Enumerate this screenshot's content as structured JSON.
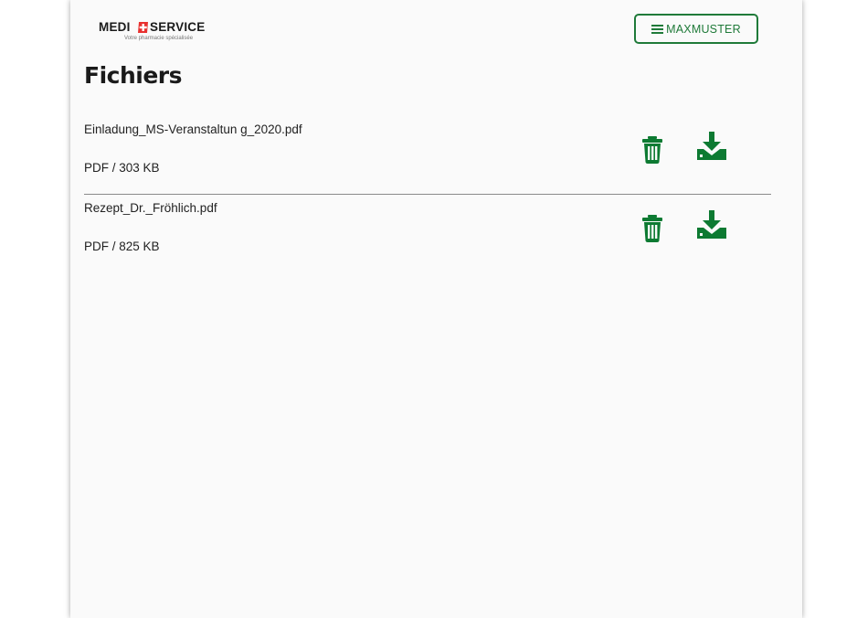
{
  "header": {
    "logo": {
      "word_left": "MEDI",
      "word_right": "SERVICE",
      "tagline": "Votre pharmacie spécialisée",
      "cross_color": "#e8312f"
    },
    "menu_button": {
      "icon": "hamburger-icon",
      "label": "MAXMUSTER"
    }
  },
  "main": {
    "title": "Fichiers",
    "files": [
      {
        "name": "Einladung_MS-Veranstaltun g_2020.pdf",
        "meta": "PDF / 303 KB",
        "delete_icon": "trash-icon",
        "download_icon": "download-icon"
      },
      {
        "name": "Rezept_Dr._Fröhlich.pdf",
        "meta": "PDF / 825 KB",
        "delete_icon": "trash-icon",
        "download_icon": "download-icon"
      }
    ]
  },
  "colors": {
    "accent_green": "#1f7a39",
    "icon_green": "#0d7a32",
    "text": "#222222",
    "page_bg": "#fafafa"
  }
}
